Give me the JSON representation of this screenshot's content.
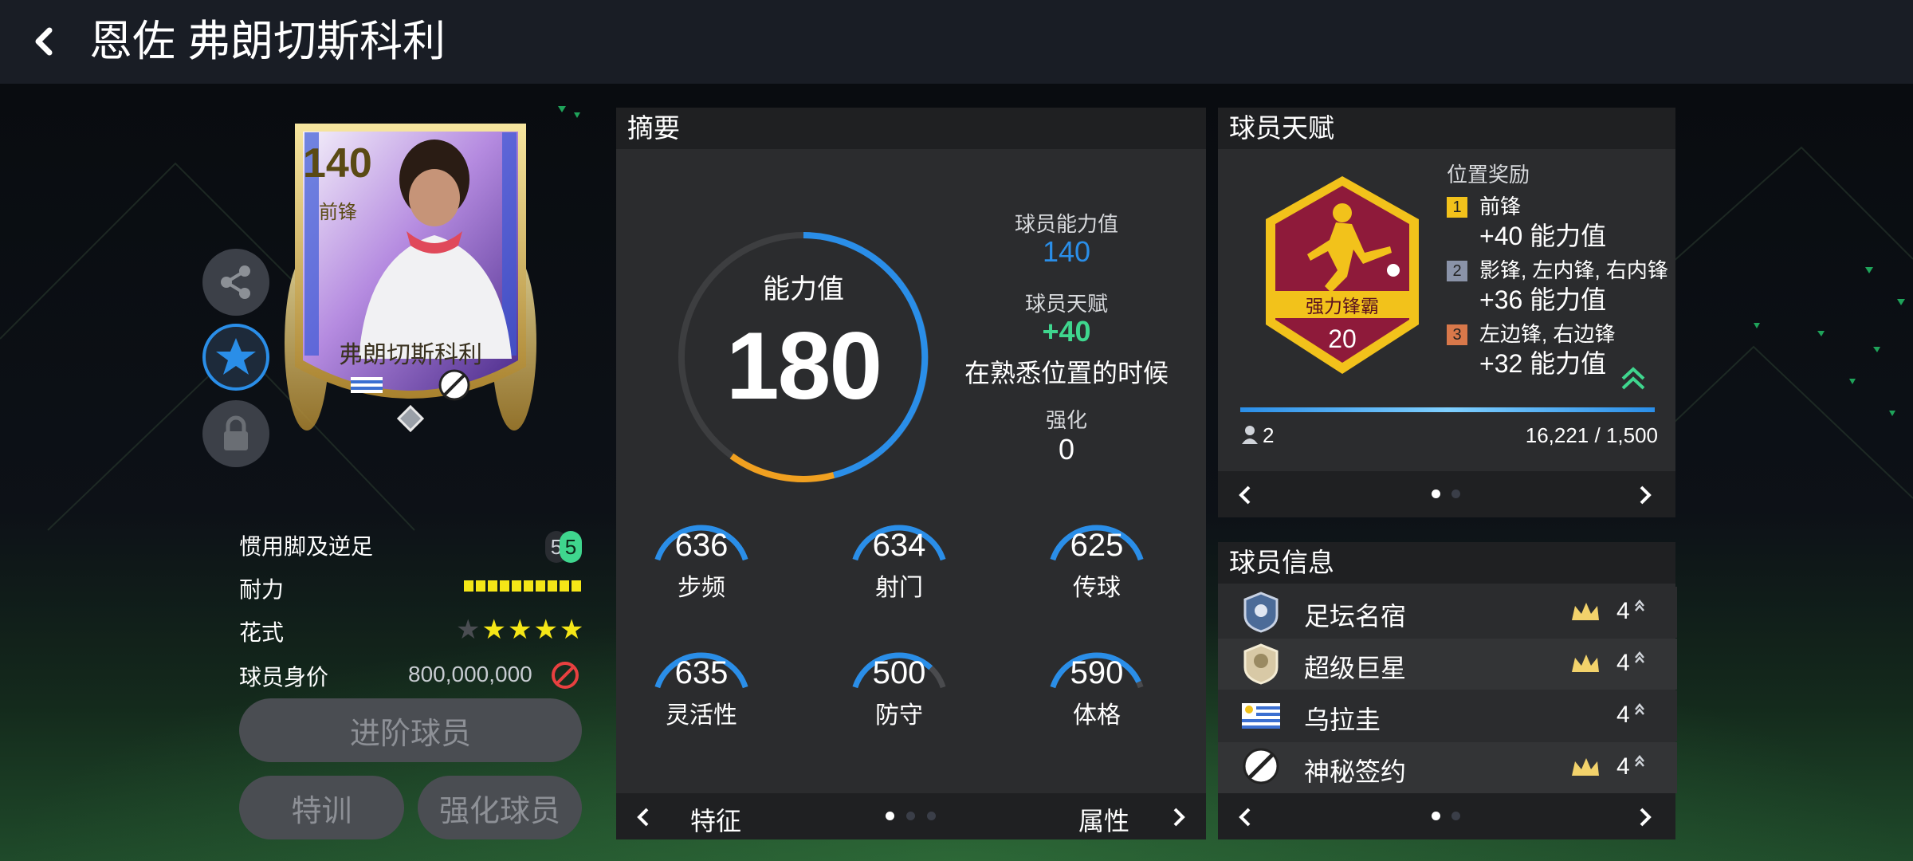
{
  "header": {
    "title": "恩佐 弗朗切斯科利"
  },
  "card": {
    "rating": "140",
    "position": "前锋",
    "name": "弗朗切斯科利"
  },
  "player_info": {
    "foot_label": "惯用脚及逆足",
    "foot_value_left": "5",
    "foot_value_right": "5",
    "stamina_label": "耐力",
    "stamina_level": 1.0,
    "skill_label": "花式",
    "skill_stars": 4,
    "skill_max": 5,
    "value_label": "球员身价",
    "value": "800,000,000"
  },
  "buttons": {
    "advance": "进阶球员",
    "train": "特训",
    "enhance": "强化球员"
  },
  "summary": {
    "title": "摘要",
    "ability_label": "能力值",
    "ability_value": "180",
    "player_rating_label": "球员能力值",
    "player_rating_value": "140",
    "talent_label": "球员天赋",
    "talent_value": "+40",
    "talent_note": "在熟悉位置的时候",
    "enhance_label": "强化",
    "enhance_value": "0",
    "stats": [
      {
        "value": "636",
        "label": "步频",
        "ratio": 1.0
      },
      {
        "value": "634",
        "label": "射门",
        "ratio": 1.0
      },
      {
        "value": "625",
        "label": "传球",
        "ratio": 1.0
      },
      {
        "value": "635",
        "label": "灵活性",
        "ratio": 1.0
      },
      {
        "value": "500",
        "label": "防守",
        "ratio": 0.8
      },
      {
        "value": "590",
        "label": "体格",
        "ratio": 0.95
      }
    ],
    "nav_left": "特征",
    "nav_right": "属性"
  },
  "talent": {
    "title": "球员天赋",
    "badge_name": "强力锋霸",
    "badge_level": "20",
    "bonus_title": "位置奖励",
    "bonuses": [
      {
        "rank": "1",
        "positions": "前锋",
        "bonus": "+40 能力值"
      },
      {
        "rank": "2",
        "positions": "影锋, 左内锋, 右内锋",
        "bonus": "+36 能力值"
      },
      {
        "rank": "3",
        "positions": "左边锋, 右边锋",
        "bonus": "+32 能力值"
      }
    ],
    "count": "2",
    "progress_text": "16,221 / 1,500",
    "progress": 1.0
  },
  "info_panel": {
    "title": "球员信息",
    "rows": [
      {
        "name": "足坛名宿",
        "num": "4"
      },
      {
        "name": "超级巨星",
        "num": "4"
      },
      {
        "name": "乌拉圭",
        "num": "4"
      },
      {
        "name": "神秘签约",
        "num": "4"
      }
    ]
  },
  "colors": {
    "accent_blue": "#2a8ee8",
    "green": "#3fd68e",
    "gold": "#f2c21b",
    "yellow": "#f5e617"
  }
}
